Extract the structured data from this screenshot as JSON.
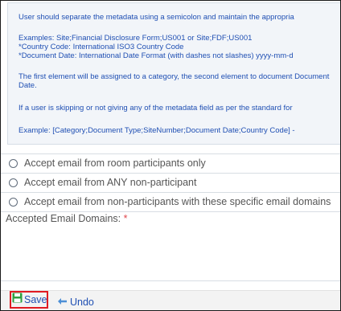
{
  "info_panel": {
    "line1": "User should separate the metadata using a semicolon and maintain the appropria",
    "examples_line1": "Examples: Site;Financial Disclosure Form;US001 or Site;FDF;US001",
    "examples_line2": "*Country Code: International ISO3 Country Code",
    "examples_line3": "*Document Date: International Date Format (with dashes not slashes) yyyy-mm-d",
    "first_element": "The first element will be assigned to a category, the second element to document Document Date.",
    "skipping": "If a user is skipping or not giving any of the metadata field as per the standard for",
    "example": "Example: [Category;Document Type;SiteNumber;Document Date;Country Code] -"
  },
  "options": [
    {
      "label": "Accept email from room participants only"
    },
    {
      "label": "Accept email from ANY non-participant"
    },
    {
      "label": "Accept email from non-participants with these specific email domains"
    }
  ],
  "domains_field": {
    "label": "Accepted Email Domains:",
    "required_mark": "*",
    "value": ""
  },
  "footer": {
    "save_label": "Save",
    "undo_label": "Undo"
  },
  "colors": {
    "info_text": "#1f4fb3",
    "save_highlight": "#e01b22",
    "save_icon": "#2e9e3e"
  }
}
